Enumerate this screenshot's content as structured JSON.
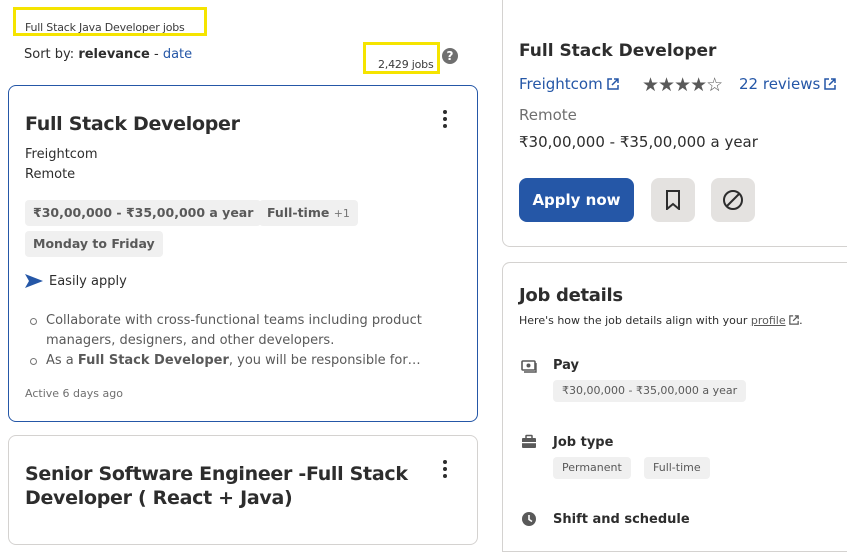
{
  "search": {
    "query_label": "Full Stack Java Developer jobs",
    "sort_prefix": "Sort by:",
    "sort_active": "relevance",
    "sort_sep": "-",
    "sort_alt": "date",
    "count": "2,429 jobs",
    "help": "?"
  },
  "cards": [
    {
      "title": "Full Stack Developer",
      "company": "Freightcom",
      "location": "Remote",
      "salary": "₹30,00,000 - ₹35,00,000 a year",
      "job_type": "Full-time",
      "job_type_more": "+1",
      "schedule": "Monday to Friday",
      "easy_apply": "Easily apply",
      "bullet1": "Collaborate with cross-functional teams including product managers, designers, and other developers.",
      "bullet2_pre": "As a ",
      "bullet2_bold": "Full Stack Developer",
      "bullet2_post": ", you will be responsible for…",
      "posted": "Active 6 days ago"
    },
    {
      "title_line1": "Senior Software Engineer -Full Stack",
      "title_line2": "Developer ( React + Java)"
    }
  ],
  "detail": {
    "title": "Full Stack Developer",
    "company": "Freightcom",
    "rating": 4,
    "stars_filled": "★★★★",
    "stars_empty": "☆",
    "reviews": "22 reviews",
    "location": "Remote",
    "pay": "₹30,00,000 - ₹35,00,000 a year",
    "apply_label": "Apply now",
    "section_title": "Job details",
    "section_sub": "Here's how the job details align with your",
    "profile_link": "profile",
    "pay_label": "Pay",
    "pay_tag": "₹30,00,000 - ₹35,00,000 a year",
    "job_type_label": "Job type",
    "job_type_tags": [
      "Permanent",
      "Full-time"
    ],
    "shift_label": "Shift and schedule"
  },
  "colors": {
    "accent": "#2557a7",
    "highlight": "#f5e400"
  },
  "icons": [
    "help-icon",
    "kebab-icon",
    "send-icon",
    "external-link-icon",
    "bookmark-icon",
    "not-interested-icon",
    "pay-icon",
    "briefcase-icon",
    "clock-icon"
  ]
}
